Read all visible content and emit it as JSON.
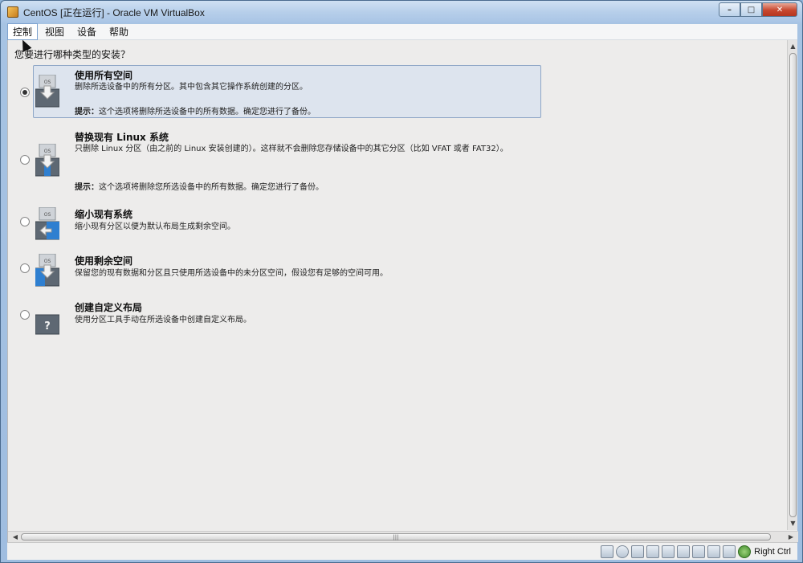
{
  "window": {
    "title": "CentOS [正在运行] - Oracle VM VirtualBox",
    "minimize_glyph": "–",
    "maximize_glyph": "□",
    "close_glyph": "✕"
  },
  "menubar": {
    "items": [
      {
        "label": "控制"
      },
      {
        "label": "视图"
      },
      {
        "label": "设备"
      },
      {
        "label": "帮助"
      }
    ]
  },
  "installer": {
    "question": "您要进行哪种类型的安装？",
    "options": [
      {
        "title": "使用所有空间",
        "desc": "删除所选设备中的所有分区。其中包含其它操作系统创建的分区。",
        "hint_label": "提示：",
        "hint_text": "这个选项将删除所选设备中的所有数据。确定您进行了备份。",
        "selected": true,
        "icon": "os-disk-icon"
      },
      {
        "title": "替换现有 Linux 系统",
        "desc": "只删除 Linux 分区（由之前的 Linux 安装创建的）。这样就不会删除您存储设备中的其它分区（比如 VFAT 或者 FAT32）。",
        "hint_label": "提示：",
        "hint_text": "这个选项将删除您所选设备中的所有数据。确定您进行了备份。",
        "selected": false,
        "icon": "os-disk-icon"
      },
      {
        "title": "缩小现有系统",
        "desc": "缩小现有分区以便为默认布局生成剩余空间。",
        "selected": false,
        "icon": "os-disk-icon"
      },
      {
        "title": "使用剩余空间",
        "desc": "保留您的现有数据和分区且只使用所选设备中的未分区空间，假设您有足够的空间可用。",
        "selected": false,
        "icon": "os-disk-icon"
      },
      {
        "title": "创建自定义布局",
        "desc": "使用分区工具手动在所选设备中创建自定义布局。",
        "selected": false,
        "icon": "question-disk-icon"
      }
    ]
  },
  "scrollbars": {
    "up_arrow": "▲",
    "down_arrow": "▼",
    "left_arrow": "◀",
    "right_arrow": "▶",
    "hthumb_grip": "|||"
  },
  "statusbar": {
    "host_key": "Right Ctrl"
  },
  "colors": {
    "selection_bg": "#dde4ee",
    "selection_border": "#8ea6c6",
    "guest_bg": "#edeceb"
  }
}
